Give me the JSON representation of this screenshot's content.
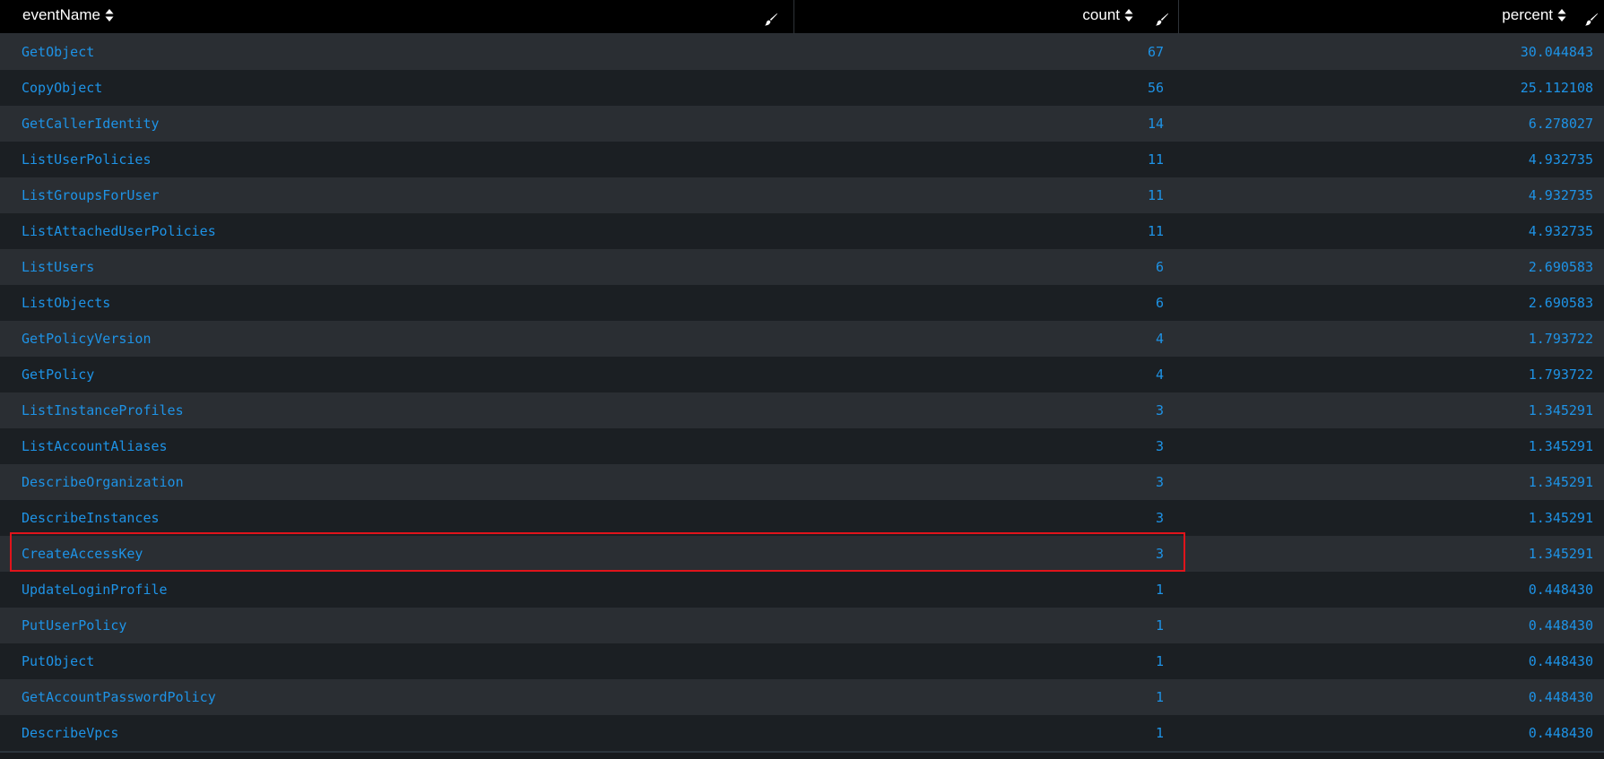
{
  "columns": [
    {
      "label": "eventName"
    },
    {
      "label": "count"
    },
    {
      "label": "percent"
    }
  ],
  "rows": [
    {
      "name": "GetObject",
      "count": "67",
      "percent": "30.044843"
    },
    {
      "name": "CopyObject",
      "count": "56",
      "percent": "25.112108"
    },
    {
      "name": "GetCallerIdentity",
      "count": "14",
      "percent": "6.278027"
    },
    {
      "name": "ListUserPolicies",
      "count": "11",
      "percent": "4.932735"
    },
    {
      "name": "ListGroupsForUser",
      "count": "11",
      "percent": "4.932735"
    },
    {
      "name": "ListAttachedUserPolicies",
      "count": "11",
      "percent": "4.932735"
    },
    {
      "name": "ListUsers",
      "count": "6",
      "percent": "2.690583"
    },
    {
      "name": "ListObjects",
      "count": "6",
      "percent": "2.690583"
    },
    {
      "name": "GetPolicyVersion",
      "count": "4",
      "percent": "1.793722"
    },
    {
      "name": "GetPolicy",
      "count": "4",
      "percent": "1.793722"
    },
    {
      "name": "ListInstanceProfiles",
      "count": "3",
      "percent": "1.345291"
    },
    {
      "name": "ListAccountAliases",
      "count": "3",
      "percent": "1.345291"
    },
    {
      "name": "DescribeOrganization",
      "count": "3",
      "percent": "1.345291"
    },
    {
      "name": "DescribeInstances",
      "count": "3",
      "percent": "1.345291"
    },
    {
      "name": "CreateAccessKey",
      "count": "3",
      "percent": "1.345291"
    },
    {
      "name": "UpdateLoginProfile",
      "count": "1",
      "percent": "0.448430"
    },
    {
      "name": "PutUserPolicy",
      "count": "1",
      "percent": "0.448430"
    },
    {
      "name": "PutObject",
      "count": "1",
      "percent": "0.448430"
    },
    {
      "name": "GetAccountPasswordPolicy",
      "count": "1",
      "percent": "0.448430"
    },
    {
      "name": "DescribeVpcs",
      "count": "1",
      "percent": "0.448430"
    }
  ],
  "highlighted_row": "CreateAccessKey",
  "colors": {
    "header_bg": "#000000",
    "row_even_bg": "#2a2e33",
    "row_odd_bg": "#1b1f23",
    "link_text": "#1e93e6",
    "highlight_border": "#e0141b"
  },
  "icons": {
    "sort": "sort-icon",
    "edit": "paintbrush-edit-icon"
  }
}
